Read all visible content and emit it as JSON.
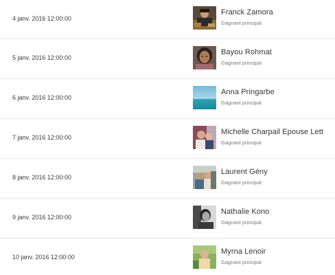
{
  "winners": [
    {
      "date": "4 janv. 2016 12:00:00",
      "name": "Franck Zamora",
      "role": "Gagnant principal",
      "avatar_icon": "avatar-photo-icon"
    },
    {
      "date": "5 janv. 2016 12:00:00",
      "name": "Bayou Rohmat",
      "role": "Gagnant principal",
      "avatar_icon": "avatar-photo-icon"
    },
    {
      "date": "6 janv. 2016 12:00:00",
      "name": "Anna Pringarbe",
      "role": "Gagnant principal",
      "avatar_icon": "avatar-photo-icon"
    },
    {
      "date": "7 janv. 2016 12:00:00",
      "name": "Michelle Charpail Epouse Lett",
      "role": "Gagnant principal",
      "avatar_icon": "avatar-photo-icon"
    },
    {
      "date": "8 janv. 2016 12:00:00",
      "name": "Laurent Gény",
      "role": "Gagnant principal",
      "avatar_icon": "avatar-photo-icon"
    },
    {
      "date": "9 janv. 2016 12:00:00",
      "name": "Nathalie Kono",
      "role": "Gagnant principal",
      "avatar_icon": "avatar-photo-icon"
    },
    {
      "date": "10 janv. 2016 12:00:00",
      "name": "Myrna Lenoir",
      "role": "Gagnant principal",
      "avatar_icon": "avatar-photo-icon"
    }
  ]
}
